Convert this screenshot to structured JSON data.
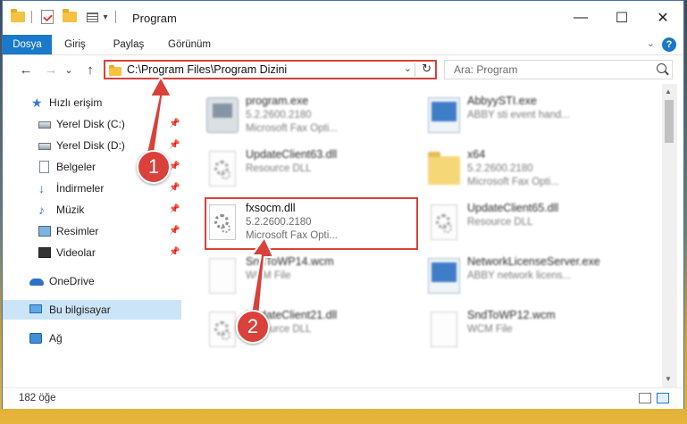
{
  "window": {
    "title": "Program",
    "controls": {
      "minimize": "—",
      "maximize": "☐",
      "close": "✕"
    }
  },
  "ribbon": {
    "tabs": [
      {
        "label": "Dosya",
        "active": true
      },
      {
        "label": "Giriş"
      },
      {
        "label": "Paylaş"
      },
      {
        "label": "Görünüm"
      }
    ],
    "help": "?"
  },
  "nav": {
    "back": "←",
    "forward": "→",
    "recent": "⌄",
    "up": "↑",
    "address": "C:\\Program Files\\Program Dizini",
    "search_placeholder": "Ara: Program"
  },
  "sidebar": {
    "items": [
      {
        "label": "Hızlı erişim",
        "icon": "star-icon",
        "pinned": false
      },
      {
        "label": "Yerel Disk (C:)",
        "icon": "disk-icon",
        "pinned": true
      },
      {
        "label": "Yerel Disk (D:)",
        "icon": "disk-icon",
        "pinned": true
      },
      {
        "label": "Belgeler",
        "icon": "document-icon",
        "pinned": true
      },
      {
        "label": "İndirmeler",
        "icon": "download-icon",
        "pinned": true
      },
      {
        "label": "Müzik",
        "icon": "music-icon",
        "pinned": true
      },
      {
        "label": "Resimler",
        "icon": "pictures-icon",
        "pinned": true
      },
      {
        "label": "Videolar",
        "icon": "videos-icon",
        "pinned": true
      },
      {
        "label": "OneDrive",
        "icon": "cloud-icon",
        "pinned": false
      },
      {
        "label": "Bu bilgisayar",
        "icon": "computer-icon",
        "pinned": false,
        "selected": true
      },
      {
        "label": "Ağ",
        "icon": "network-icon",
        "pinned": false
      }
    ]
  },
  "files": [
    {
      "name": "program.exe",
      "line2": "5.2.2600.2180",
      "line3": "Microsoft  Fax Opti...",
      "icon": "setup-icon"
    },
    {
      "name": "AbbyySTI.exe",
      "line2": "ABBY sti event hand...",
      "line3": "",
      "icon": "exe-icon"
    },
    {
      "name": "UpdateClient63.dll",
      "line2": "Resource DLL",
      "line3": "",
      "icon": "dll-icon"
    },
    {
      "name": "x64",
      "line2": "5.2.2600.2180",
      "line3": "Microsoft  Fax Opti...",
      "icon": "folder-icon"
    },
    {
      "name": "fxsocm.dll",
      "line2": "5.2.2600.2180",
      "line3": "Microsoft  Fax Opti...",
      "icon": "dll-icon",
      "highlighted": true
    },
    {
      "name": "UpdateClient65.dll",
      "line2": "Resource DLL",
      "line3": "",
      "icon": "dll-icon"
    },
    {
      "name": "SndToWP14.wcm",
      "line2": "WCM File",
      "line3": "",
      "icon": "page-icon"
    },
    {
      "name": "NetworkLicenseServer.exe",
      "line2": "ABBY network licens...",
      "line3": "",
      "icon": "exe-icon"
    },
    {
      "name": "UpdateClient21.dll",
      "line2": "Resource DLL",
      "line3": "",
      "icon": "dll-icon"
    },
    {
      "name": "SndToWP12.wcm",
      "line2": "WCM File",
      "line3": "",
      "icon": "page-icon"
    }
  ],
  "status": {
    "count": "182 öğe"
  },
  "callouts": [
    {
      "label": "1"
    },
    {
      "label": "2"
    }
  ],
  "colors": {
    "accent": "#1979ca",
    "callout": "#d9413a",
    "selection": "#cce4f7"
  }
}
